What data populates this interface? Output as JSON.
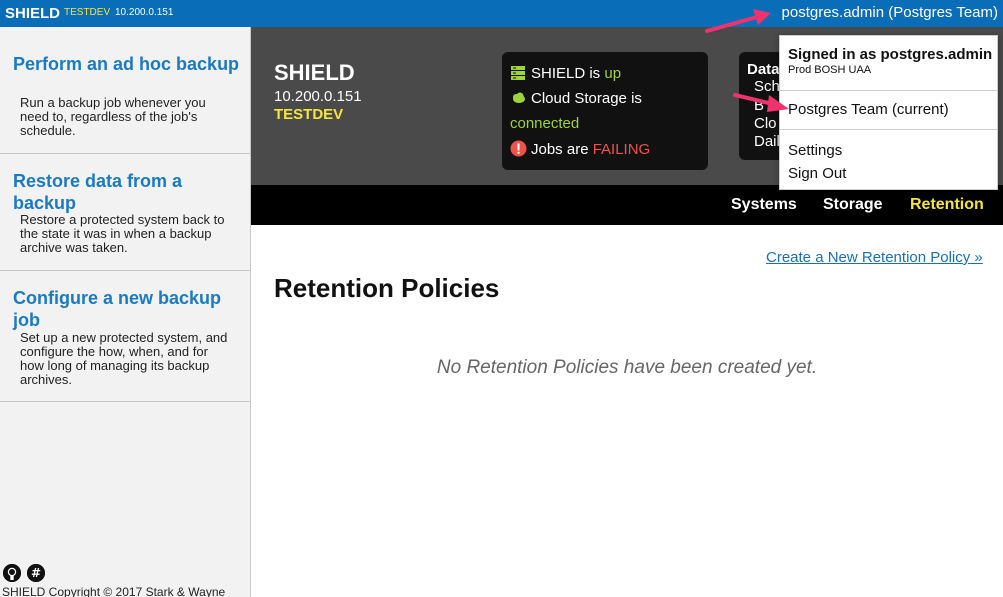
{
  "topbar": {
    "brand": "SHIELD",
    "env": "TESTDEV",
    "ip": "10.200.0.151",
    "user_menu": "postgres.admin (Postgres Team)"
  },
  "sidebar": {
    "items": [
      {
        "title": "Perform an ad hoc backup",
        "desc": "Run a backup job whenever you need to, regardless of the job's schedule."
      },
      {
        "title": "Restore data from a backup",
        "desc": "Restore a protected system back to the state it was in when a backup archive was taken."
      },
      {
        "title": "Configure a new backup job",
        "desc": "Set up a new protected system, and configure the how, when, and for how long of managing its backup archives."
      }
    ],
    "icons": [
      "github-icon",
      "slack-icon"
    ],
    "copyright": "SHIELD Copyright © 2017 Stark & Wayne"
  },
  "hero": {
    "name": "SHIELD",
    "ip": "10.200.0.151",
    "env": "TESTDEV",
    "status": {
      "shield_prefix": "SHIELD is ",
      "shield_state": "up",
      "storage_prefix": "Cloud Storage is",
      "storage_state": "connected",
      "jobs_prefix": "Jobs are ",
      "jobs_state": "FAILING"
    },
    "data_lines": [
      "Data",
      "Sch",
      "B",
      "Clo",
      "Dail"
    ],
    "colors": {
      "ok": "#9fd33b",
      "bad": "#f0524a",
      "accent": "#f5e63b"
    }
  },
  "nav": {
    "tabs": [
      "Systems",
      "Storage",
      "Retention"
    ],
    "active": "Retention"
  },
  "main": {
    "create_link": "Create a New Retention Policy »",
    "title": "Retention Policies",
    "empty": "No Retention Policies have been created yet."
  },
  "dropdown": {
    "signed_in": "Signed in as postgres.admin",
    "provider": "Prod BOSH UAA",
    "team": "Postgres Team (current)",
    "settings": "Settings",
    "signout": "Sign Out"
  }
}
